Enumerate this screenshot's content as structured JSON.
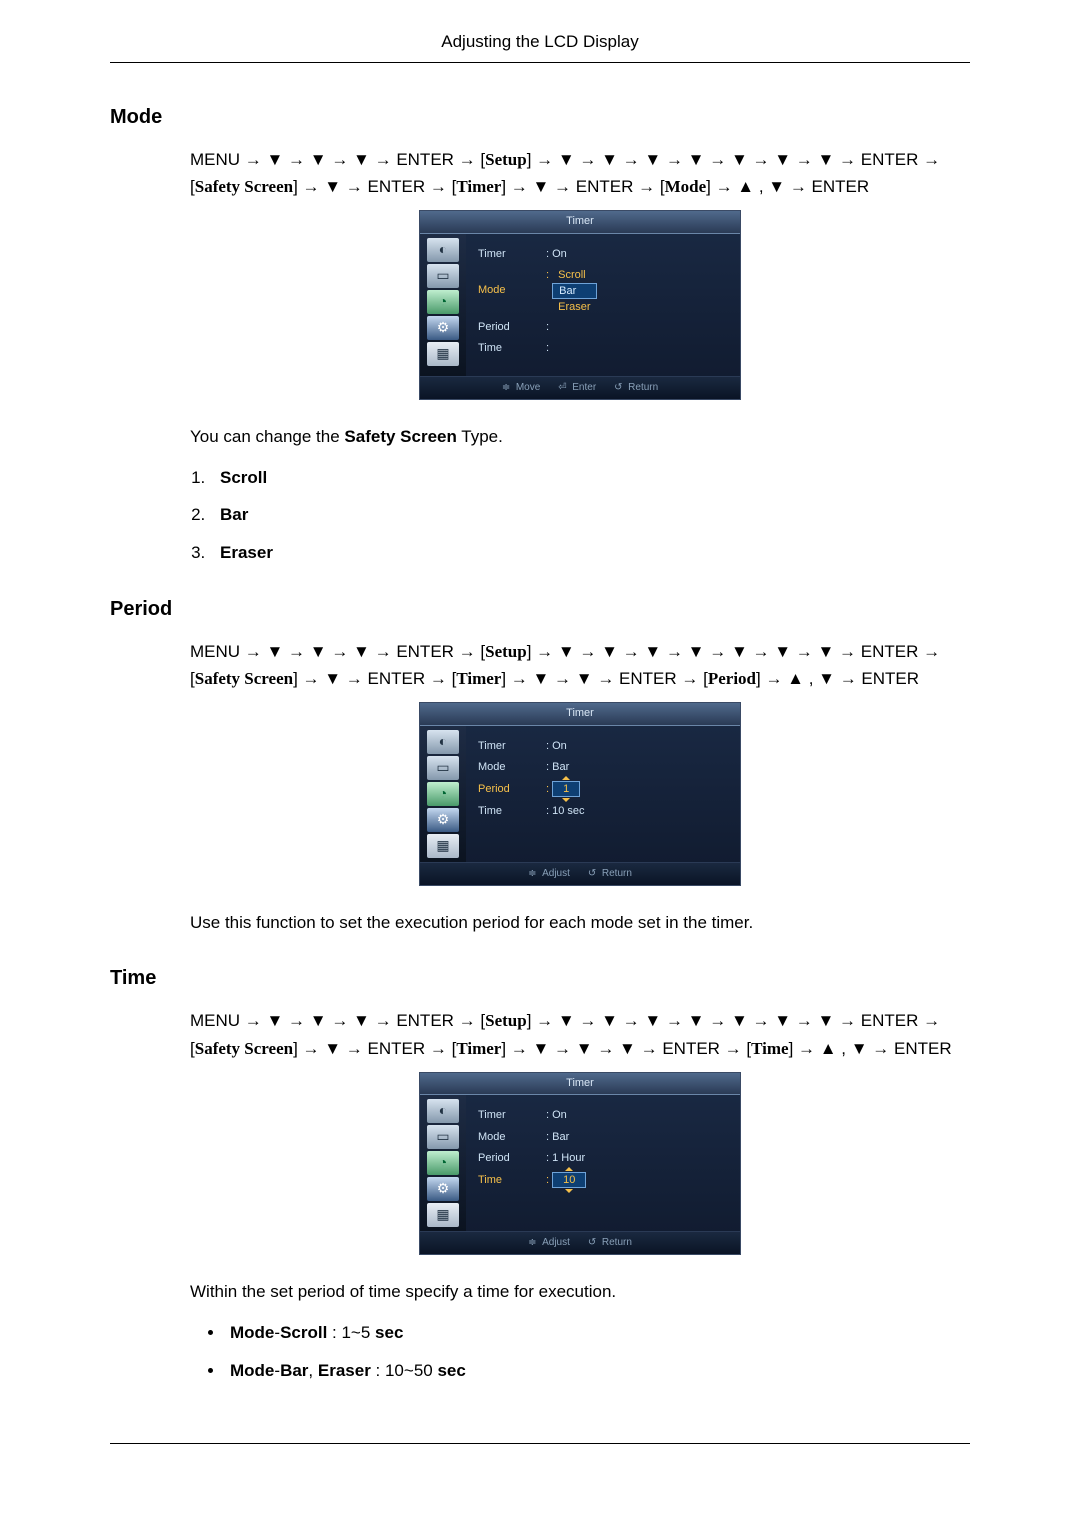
{
  "header": {
    "title": "Adjusting the LCD Display"
  },
  "symbols": {
    "arrow": "→",
    "down": "▼",
    "up": "▲"
  },
  "section_mode": {
    "heading": "Mode",
    "path_tokens_line1": [
      "MENU",
      "→",
      "▼",
      "→",
      "▼",
      "→",
      "▼",
      "→",
      "ENTER",
      "→",
      "[Setup]",
      "→",
      "▼",
      "→",
      "▼",
      "→",
      "▼",
      "→",
      "▼",
      "→",
      "▼",
      "→",
      "▼",
      "→",
      "▼",
      "→",
      "ENTER",
      "→"
    ],
    "path_tokens_line2": [
      "[Safety Screen]",
      "→",
      "▼",
      "→",
      "ENTER",
      "→",
      "[Timer]",
      "→",
      "▼",
      "→",
      "ENTER",
      "→",
      "[Mode]",
      "→",
      "▲",
      ",",
      "▼",
      "→",
      "ENTER"
    ],
    "osd": {
      "title": "Timer",
      "rows": [
        {
          "k": "Timer",
          "v": ": On"
        },
        {
          "k": "Mode",
          "v_options": [
            "Scroll",
            "Bar",
            "Eraser"
          ],
          "selected": 1,
          "hl": true
        },
        {
          "k": "Period",
          "v": ":"
        },
        {
          "k": "Time",
          "v": ":"
        }
      ],
      "footer": [
        {
          "i": "≑",
          "t": "Move"
        },
        {
          "i": "⏎",
          "t": "Enter"
        },
        {
          "i": "↺",
          "t": "Return"
        }
      ]
    },
    "desc_pre": "You can change the ",
    "desc_bold": "Safety Screen",
    "desc_post": " Type.",
    "options": [
      "Scroll",
      "Bar",
      "Eraser"
    ]
  },
  "section_period": {
    "heading": "Period",
    "path_tokens_line1": [
      "MENU",
      "→",
      "▼",
      "→",
      "▼",
      "→",
      "▼",
      "→",
      "ENTER",
      "→",
      "[Setup]",
      "→",
      "▼",
      "→",
      "▼",
      "→",
      "▼",
      "→",
      "▼",
      "→",
      "▼",
      "→",
      "▼",
      "→",
      "▼",
      "→",
      "ENTER",
      "→"
    ],
    "path_tokens_line2": [
      "[Safety Screen]",
      "→",
      "▼",
      "→",
      "ENTER",
      "→",
      "[Timer]",
      "→",
      "▼",
      "→",
      "▼",
      "→",
      "ENTER",
      "→",
      "[Period]",
      "→",
      "▲",
      ",",
      "▼",
      "→",
      "ENTER"
    ],
    "osd": {
      "title": "Timer",
      "rows": [
        {
          "k": "Timer",
          "v": ": On"
        },
        {
          "k": "Mode",
          "v": ": Bar"
        },
        {
          "k": "Period",
          "v_spin": "1",
          "hl": true
        },
        {
          "k": "Time",
          "v": ": 10 sec"
        }
      ],
      "footer": [
        {
          "i": "≑",
          "t": "Adjust"
        },
        {
          "i": "↺",
          "t": "Return"
        }
      ]
    },
    "desc": "Use this function to set the execution period for each mode set in the timer."
  },
  "section_time": {
    "heading": "Time",
    "path_tokens_line1": [
      "MENU",
      "→",
      "▼",
      "→",
      "▼",
      "→",
      "▼",
      "→",
      "ENTER",
      "→",
      "[Setup]",
      "→",
      "▼",
      "→",
      "▼",
      "→",
      "▼",
      "→",
      "▼",
      "→",
      "▼",
      "→",
      "▼",
      "→",
      "▼",
      "→",
      "ENTER",
      "→"
    ],
    "path_tokens_line2": [
      "[Safety Screen]",
      "→",
      "▼",
      "→",
      "ENTER",
      "→",
      "[Timer]",
      "→",
      "▼",
      "→",
      "▼",
      "→",
      "▼",
      "→",
      "ENTER",
      "→",
      "[Time]",
      "→",
      "▲",
      ",",
      "▼",
      "→",
      "ENTER"
    ],
    "osd": {
      "title": "Timer",
      "rows": [
        {
          "k": "Timer",
          "v": ": On"
        },
        {
          "k": "Mode",
          "v": ": Bar"
        },
        {
          "k": "Period",
          "v": ": 1 Hour"
        },
        {
          "k": "Time",
          "v_spin": "10",
          "hl": true
        }
      ],
      "footer": [
        {
          "i": "≑",
          "t": "Adjust"
        },
        {
          "i": "↺",
          "t": "Return"
        }
      ]
    },
    "desc": "Within the set period of time specify a time for execution.",
    "bullets": [
      {
        "b1": "Mode",
        "sep1": "-",
        "b2": "Scroll",
        "rest": " : 1~5 ",
        "b3": "sec"
      },
      {
        "b1": "Mode",
        "sep1": "-",
        "b2": "Bar",
        "sep2": ", ",
        "b3": "Eraser",
        "rest": " : 10~50 ",
        "b4": "sec"
      }
    ]
  }
}
